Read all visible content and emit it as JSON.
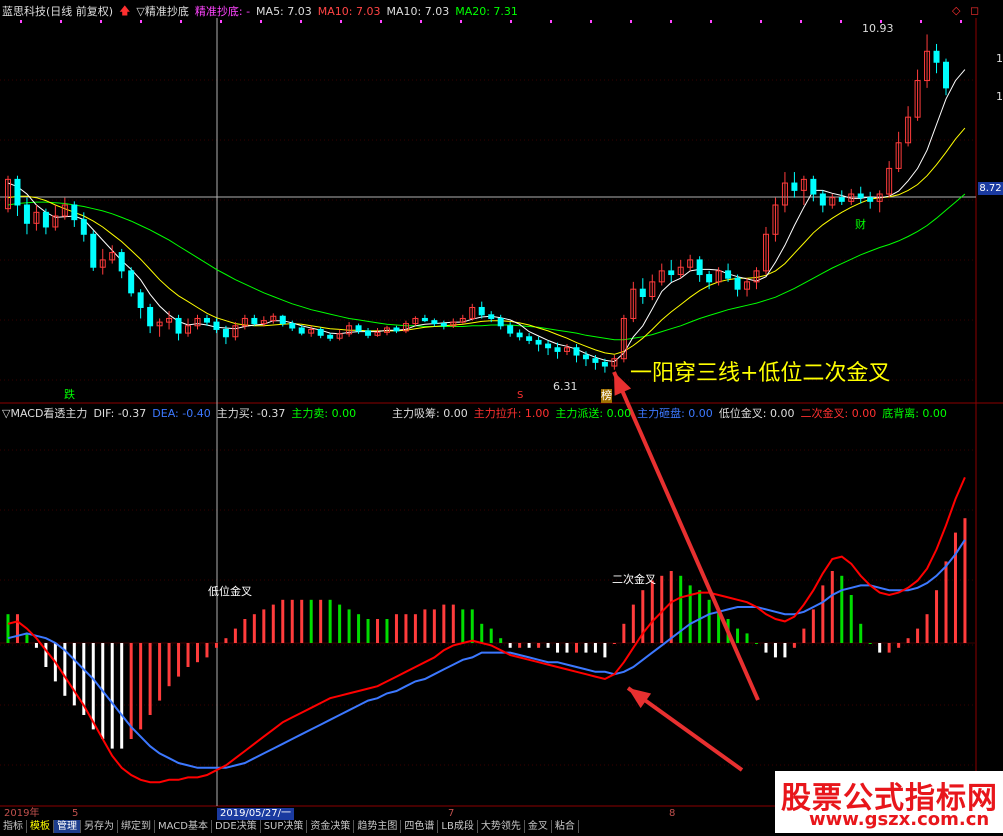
{
  "header": {
    "stock_title": "蓝思科技(日线 前复权)",
    "indicator_name": "▽精准抄底",
    "indicator_label": "精准抄底: -",
    "ma5": "MA5: 7.03",
    "ma10": "MA10: 7.03",
    "ma10b": "MA10: 7.03",
    "ma20": "MA20: 7.31"
  },
  "price_panel": {
    "high_label": "10.93",
    "low_label": "6.31",
    "current_price_tag": "8.72",
    "right_ticks": [
      "1",
      "1"
    ],
    "markers": {
      "die": "跌",
      "bang": "榜",
      "cai": "财",
      "s": "S"
    },
    "annotation": "一阳穿三线+低位二次金叉"
  },
  "macd_header": {
    "name": "▽MACD看透主力",
    "dif": "DIF: -0.37",
    "dea": "DEA: -0.40",
    "zlm": "主力买: -0.37",
    "zlmc": "主力卖: 0.00",
    "xichou": "主力吸筹: 0.00",
    "lasheng": "主力拉升: 1.00",
    "paisong": "主力派送: 0.00",
    "zapan": "主力砸盘: 0.00",
    "dwjc": "低位金叉: 0.00",
    "ecjc": "二次金叉: 0.00",
    "dbl": "底背离: 0.00"
  },
  "macd_panel": {
    "label_low_cross": "低位金叉",
    "label_second_cross": "二次金叉"
  },
  "x_axis": {
    "year": "2019年",
    "m5": "5",
    "date_cursor": "2019/05/27/一",
    "m7": "7",
    "m8": "8"
  },
  "tabs": [
    "指标",
    "模板",
    "管理",
    "另存为",
    "绑定到",
    "MACD基本",
    "DDE决策",
    "SUP决策",
    "资金决策",
    "趋势主图",
    "四色谱",
    "LB成段",
    "大势领先",
    "金叉",
    "粘合"
  ],
  "watermark": {
    "line1": "股票公式指标网",
    "line2": "www.gszx.com.cn"
  },
  "colors": {
    "up": "#ff3c3c",
    "down": "#00ffff",
    "ma5": "#ffffff",
    "ma10": "#ffff00",
    "ma20": "#00ff00",
    "dif": "#ff0000",
    "dea": "#3c78ff",
    "annot": "#ffff00"
  },
  "chart_data": {
    "type": "candlestick",
    "candles": [
      {
        "o": 8.55,
        "c": 8.95,
        "h": 9.0,
        "l": 8.5
      },
      {
        "o": 8.95,
        "c": 8.6,
        "h": 9.0,
        "l": 8.45
      },
      {
        "o": 8.6,
        "c": 8.35,
        "h": 8.7,
        "l": 8.2
      },
      {
        "o": 8.35,
        "c": 8.5,
        "h": 8.6,
        "l": 8.25
      },
      {
        "o": 8.5,
        "c": 8.3,
        "h": 8.55,
        "l": 8.2
      },
      {
        "o": 8.3,
        "c": 8.45,
        "h": 8.6,
        "l": 8.25
      },
      {
        "o": 8.45,
        "c": 8.6,
        "h": 8.7,
        "l": 8.4
      },
      {
        "o": 8.6,
        "c": 8.4,
        "h": 8.65,
        "l": 8.3
      },
      {
        "o": 8.4,
        "c": 8.2,
        "h": 8.5,
        "l": 8.1
      },
      {
        "o": 8.2,
        "c": 7.75,
        "h": 8.25,
        "l": 7.7
      },
      {
        "o": 7.75,
        "c": 7.85,
        "h": 8.0,
        "l": 7.65
      },
      {
        "o": 7.85,
        "c": 7.95,
        "h": 8.05,
        "l": 7.8
      },
      {
        "o": 7.95,
        "c": 7.7,
        "h": 8.0,
        "l": 7.6
      },
      {
        "o": 7.7,
        "c": 7.4,
        "h": 7.75,
        "l": 7.35
      },
      {
        "o": 7.4,
        "c": 7.2,
        "h": 7.45,
        "l": 7.05
      },
      {
        "o": 7.2,
        "c": 6.95,
        "h": 7.25,
        "l": 6.85
      },
      {
        "o": 6.95,
        "c": 7.0,
        "h": 7.05,
        "l": 6.8
      },
      {
        "o": 7.0,
        "c": 7.05,
        "h": 7.15,
        "l": 6.9
      },
      {
        "o": 7.05,
        "c": 6.85,
        "h": 7.1,
        "l": 6.75
      },
      {
        "o": 6.85,
        "c": 6.95,
        "h": 7.05,
        "l": 6.8
      },
      {
        "o": 6.95,
        "c": 7.05,
        "h": 7.1,
        "l": 6.9
      },
      {
        "o": 7.05,
        "c": 7.0,
        "h": 7.1,
        "l": 6.95
      },
      {
        "o": 7.0,
        "c": 6.9,
        "h": 7.05,
        "l": 6.85
      },
      {
        "o": 6.9,
        "c": 6.8,
        "h": 6.95,
        "l": 6.7
      },
      {
        "o": 6.8,
        "c": 6.95,
        "h": 7.0,
        "l": 6.75
      },
      {
        "o": 6.95,
        "c": 7.05,
        "h": 7.1,
        "l": 6.9
      },
      {
        "o": 7.05,
        "c": 6.98,
        "h": 7.1,
        "l": 6.95
      },
      {
        "o": 6.98,
        "c": 7.02,
        "h": 7.08,
        "l": 6.94
      },
      {
        "o": 7.02,
        "c": 7.08,
        "h": 7.12,
        "l": 6.98
      },
      {
        "o": 7.08,
        "c": 6.98,
        "h": 7.1,
        "l": 6.94
      },
      {
        "o": 6.98,
        "c": 6.92,
        "h": 7.02,
        "l": 6.88
      },
      {
        "o": 6.92,
        "c": 6.85,
        "h": 6.96,
        "l": 6.82
      },
      {
        "o": 6.85,
        "c": 6.9,
        "h": 6.95,
        "l": 6.8
      },
      {
        "o": 6.9,
        "c": 6.82,
        "h": 6.93,
        "l": 6.78
      },
      {
        "o": 6.82,
        "c": 6.78,
        "h": 6.85,
        "l": 6.74
      },
      {
        "o": 6.78,
        "c": 6.84,
        "h": 6.9,
        "l": 6.75
      },
      {
        "o": 6.84,
        "c": 6.95,
        "h": 7.0,
        "l": 6.8
      },
      {
        "o": 6.95,
        "c": 6.88,
        "h": 6.98,
        "l": 6.84
      },
      {
        "o": 6.88,
        "c": 6.82,
        "h": 6.92,
        "l": 6.78
      },
      {
        "o": 6.82,
        "c": 6.86,
        "h": 6.92,
        "l": 6.8
      },
      {
        "o": 6.86,
        "c": 6.92,
        "h": 6.95,
        "l": 6.82
      },
      {
        "o": 6.92,
        "c": 6.88,
        "h": 6.95,
        "l": 6.85
      },
      {
        "o": 6.88,
        "c": 6.98,
        "h": 7.02,
        "l": 6.85
      },
      {
        "o": 6.98,
        "c": 7.05,
        "h": 7.08,
        "l": 6.95
      },
      {
        "o": 7.05,
        "c": 7.02,
        "h": 7.1,
        "l": 7.0
      },
      {
        "o": 7.02,
        "c": 6.98,
        "h": 7.05,
        "l": 6.94
      },
      {
        "o": 6.98,
        "c": 6.95,
        "h": 7.02,
        "l": 6.9
      },
      {
        "o": 6.95,
        "c": 7.0,
        "h": 7.05,
        "l": 6.92
      },
      {
        "o": 7.0,
        "c": 7.05,
        "h": 7.1,
        "l": 6.98
      },
      {
        "o": 7.05,
        "c": 7.2,
        "h": 7.25,
        "l": 7.02
      },
      {
        "o": 7.2,
        "c": 7.1,
        "h": 7.28,
        "l": 7.05
      },
      {
        "o": 7.1,
        "c": 7.05,
        "h": 7.15,
        "l": 7.0
      },
      {
        "o": 7.05,
        "c": 6.95,
        "h": 7.1,
        "l": 6.9
      },
      {
        "o": 6.95,
        "c": 6.85,
        "h": 7.0,
        "l": 6.8
      },
      {
        "o": 6.85,
        "c": 6.8,
        "h": 6.9,
        "l": 6.75
      },
      {
        "o": 6.8,
        "c": 6.75,
        "h": 6.85,
        "l": 6.7
      },
      {
        "o": 6.75,
        "c": 6.7,
        "h": 6.8,
        "l": 6.6
      },
      {
        "o": 6.7,
        "c": 6.65,
        "h": 6.75,
        "l": 6.55
      },
      {
        "o": 6.65,
        "c": 6.6,
        "h": 6.72,
        "l": 6.5
      },
      {
        "o": 6.6,
        "c": 6.65,
        "h": 6.7,
        "l": 6.55
      },
      {
        "o": 6.65,
        "c": 6.55,
        "h": 6.7,
        "l": 6.45
      },
      {
        "o": 6.55,
        "c": 6.5,
        "h": 6.6,
        "l": 6.4
      },
      {
        "o": 6.5,
        "c": 6.45,
        "h": 6.55,
        "l": 6.35
      },
      {
        "o": 6.45,
        "c": 6.4,
        "h": 6.5,
        "l": 6.31
      },
      {
        "o": 6.4,
        "c": 6.5,
        "h": 6.55,
        "l": 6.35
      },
      {
        "o": 6.5,
        "c": 7.05,
        "h": 7.1,
        "l": 6.45
      },
      {
        "o": 7.05,
        "c": 7.45,
        "h": 7.55,
        "l": 7.0
      },
      {
        "o": 7.45,
        "c": 7.35,
        "h": 7.6,
        "l": 7.25
      },
      {
        "o": 7.35,
        "c": 7.55,
        "h": 7.65,
        "l": 7.3
      },
      {
        "o": 7.55,
        "c": 7.7,
        "h": 7.8,
        "l": 7.5
      },
      {
        "o": 7.7,
        "c": 7.65,
        "h": 7.85,
        "l": 7.55
      },
      {
        "o": 7.65,
        "c": 7.75,
        "h": 7.85,
        "l": 7.6
      },
      {
        "o": 7.75,
        "c": 7.85,
        "h": 7.92,
        "l": 7.7
      },
      {
        "o": 7.85,
        "c": 7.65,
        "h": 7.9,
        "l": 7.55
      },
      {
        "o": 7.65,
        "c": 7.55,
        "h": 7.7,
        "l": 7.45
      },
      {
        "o": 7.55,
        "c": 7.7,
        "h": 7.75,
        "l": 7.5
      },
      {
        "o": 7.7,
        "c": 7.6,
        "h": 7.8,
        "l": 7.55
      },
      {
        "o": 7.6,
        "c": 7.45,
        "h": 7.65,
        "l": 7.35
      },
      {
        "o": 7.45,
        "c": 7.55,
        "h": 7.6,
        "l": 7.35
      },
      {
        "o": 7.55,
        "c": 7.7,
        "h": 7.75,
        "l": 7.45
      },
      {
        "o": 7.7,
        "c": 8.2,
        "h": 8.3,
        "l": 7.65
      },
      {
        "o": 8.2,
        "c": 8.6,
        "h": 8.7,
        "l": 8.1
      },
      {
        "o": 8.6,
        "c": 8.9,
        "h": 9.05,
        "l": 8.5
      },
      {
        "o": 8.9,
        "c": 8.8,
        "h": 9.05,
        "l": 8.7
      },
      {
        "o": 8.8,
        "c": 8.95,
        "h": 9.0,
        "l": 8.6
      },
      {
        "o": 8.95,
        "c": 8.75,
        "h": 9.0,
        "l": 8.65
      },
      {
        "o": 8.75,
        "c": 8.6,
        "h": 8.8,
        "l": 8.5
      },
      {
        "o": 8.6,
        "c": 8.7,
        "h": 8.75,
        "l": 8.55
      },
      {
        "o": 8.7,
        "c": 8.65,
        "h": 8.8,
        "l": 8.6
      },
      {
        "o": 8.65,
        "c": 8.75,
        "h": 8.82,
        "l": 8.6
      },
      {
        "o": 8.75,
        "c": 8.7,
        "h": 8.85,
        "l": 8.62
      },
      {
        "o": 8.7,
        "c": 8.65,
        "h": 8.78,
        "l": 8.55
      },
      {
        "o": 8.65,
        "c": 8.75,
        "h": 8.8,
        "l": 8.5
      },
      {
        "o": 8.75,
        "c": 9.1,
        "h": 9.2,
        "l": 8.7
      },
      {
        "o": 9.1,
        "c": 9.45,
        "h": 9.6,
        "l": 9.05
      },
      {
        "o": 9.45,
        "c": 9.8,
        "h": 9.95,
        "l": 9.4
      },
      {
        "o": 9.8,
        "c": 10.3,
        "h": 10.45,
        "l": 9.75
      },
      {
        "o": 10.3,
        "c": 10.7,
        "h": 10.93,
        "l": 10.2
      },
      {
        "o": 10.7,
        "c": 10.55,
        "h": 10.8,
        "l": 10.4
      },
      {
        "o": 10.55,
        "c": 10.2,
        "h": 10.6,
        "l": 10.1
      }
    ],
    "ma5": [
      8.9,
      8.85,
      8.75,
      8.6,
      8.5,
      8.43,
      8.44,
      8.45,
      8.4,
      8.26,
      8.12,
      7.98,
      7.84,
      7.72,
      7.58,
      7.38,
      7.22,
      7.1,
      7.01,
      6.96,
      6.98,
      6.96,
      6.93,
      6.92,
      6.91,
      6.94,
      6.96,
      6.97,
      7.02,
      7.02,
      6.99,
      6.95,
      6.92,
      6.89,
      6.85,
      6.84,
      6.86,
      6.87,
      6.87,
      6.87,
      6.89,
      6.89,
      6.9,
      6.95,
      6.97,
      6.98,
      6.99,
      7.0,
      7.0,
      7.04,
      7.07,
      7.08,
      7.06,
      7.03,
      6.97,
      6.87,
      6.81,
      6.75,
      6.7,
      6.67,
      6.63,
      6.57,
      6.52,
      6.48,
      6.46,
      6.58,
      6.8,
      6.95,
      7.18,
      7.42,
      7.54,
      7.6,
      7.7,
      7.72,
      7.72,
      7.71,
      7.66,
      7.62,
      7.59,
      7.56,
      7.62,
      7.82,
      8.05,
      8.32,
      8.57,
      8.8,
      8.8,
      8.76,
      8.73,
      8.69,
      8.69,
      8.71,
      8.7,
      8.72,
      8.79,
      8.93,
      9.1,
      9.35,
      9.7,
      10.05,
      10.3,
      10.45
    ],
    "ma10": [
      8.7,
      8.72,
      8.72,
      8.7,
      8.66,
      8.6,
      8.55,
      8.5,
      8.45,
      8.38,
      8.3,
      8.2,
      8.1,
      7.98,
      7.86,
      7.72,
      7.58,
      7.46,
      7.36,
      7.28,
      7.2,
      7.12,
      7.06,
      7.02,
      6.98,
      6.96,
      6.95,
      6.95,
      6.96,
      6.97,
      6.98,
      6.97,
      6.95,
      6.93,
      6.91,
      6.9,
      6.89,
      6.89,
      6.88,
      6.88,
      6.88,
      6.88,
      6.89,
      6.91,
      6.93,
      6.94,
      6.95,
      6.96,
      6.97,
      6.99,
      7.01,
      7.02,
      7.02,
      7.01,
      6.99,
      6.96,
      6.92,
      6.88,
      6.83,
      6.78,
      6.72,
      6.67,
      6.62,
      6.58,
      6.56,
      6.6,
      6.68,
      6.78,
      6.9,
      7.03,
      7.14,
      7.24,
      7.34,
      7.43,
      7.5,
      7.55,
      7.58,
      7.6,
      7.6,
      7.61,
      7.64,
      7.7,
      7.8,
      7.94,
      8.08,
      8.22,
      8.33,
      8.42,
      8.5,
      8.57,
      8.63,
      8.68,
      8.7,
      8.71,
      8.74,
      8.8,
      8.88,
      9.0,
      9.15,
      9.32,
      9.5,
      9.65
    ],
    "ma20": [
      8.6,
      8.62,
      8.63,
      8.64,
      8.64,
      8.63,
      8.62,
      8.6,
      8.58,
      8.55,
      8.52,
      8.48,
      8.43,
      8.38,
      8.32,
      8.26,
      8.19,
      8.12,
      8.04,
      7.96,
      7.88,
      7.8,
      7.72,
      7.65,
      7.58,
      7.52,
      7.46,
      7.4,
      7.35,
      7.3,
      7.25,
      7.21,
      7.17,
      7.14,
      7.11,
      7.08,
      7.05,
      7.03,
      7.01,
      6.99,
      6.97,
      6.96,
      6.95,
      6.95,
      6.94,
      6.94,
      6.94,
      6.94,
      6.94,
      6.95,
      6.95,
      6.96,
      6.96,
      6.96,
      6.95,
      6.94,
      6.93,
      6.91,
      6.89,
      6.87,
      6.85,
      6.82,
      6.8,
      6.78,
      6.76,
      6.76,
      6.78,
      6.8,
      6.83,
      6.87,
      6.91,
      6.95,
      7.0,
      7.05,
      7.09,
      7.13,
      7.17,
      7.2,
      7.23,
      7.26,
      7.3,
      7.34,
      7.4,
      7.46,
      7.53,
      7.6,
      7.67,
      7.74,
      7.8,
      7.86,
      7.92,
      7.97,
      8.02,
      8.06,
      8.11,
      8.17,
      8.24,
      8.32,
      8.42,
      8.53,
      8.64,
      8.75
    ],
    "macd_dif": [
      0.08,
      0.09,
      0.06,
      0.02,
      -0.03,
      -0.08,
      -0.14,
      -0.2,
      -0.26,
      -0.33,
      -0.4,
      -0.47,
      -0.52,
      -0.55,
      -0.57,
      -0.58,
      -0.58,
      -0.57,
      -0.57,
      -0.56,
      -0.56,
      -0.55,
      -0.53,
      -0.51,
      -0.48,
      -0.45,
      -0.42,
      -0.39,
      -0.36,
      -0.33,
      -0.31,
      -0.29,
      -0.27,
      -0.25,
      -0.23,
      -0.22,
      -0.21,
      -0.2,
      -0.19,
      -0.18,
      -0.16,
      -0.14,
      -0.12,
      -0.1,
      -0.08,
      -0.06,
      -0.03,
      -0.01,
      0.0,
      0.01,
      0.0,
      -0.01,
      -0.03,
      -0.05,
      -0.06,
      -0.07,
      -0.08,
      -0.09,
      -0.1,
      -0.11,
      -0.12,
      -0.13,
      -0.14,
      -0.15,
      -0.13,
      -0.08,
      -0.02,
      0.04,
      0.09,
      0.13,
      0.17,
      0.19,
      0.2,
      0.21,
      0.21,
      0.2,
      0.19,
      0.18,
      0.17,
      0.15,
      0.12,
      0.1,
      0.09,
      0.11,
      0.16,
      0.22,
      0.29,
      0.35,
      0.36,
      0.33,
      0.28,
      0.24,
      0.21,
      0.2,
      0.21,
      0.23,
      0.26,
      0.31,
      0.39,
      0.49,
      0.6,
      0.69
    ],
    "macd_dea": [
      0.02,
      0.03,
      0.04,
      0.03,
      0.02,
      0.0,
      -0.03,
      -0.07,
      -0.11,
      -0.15,
      -0.2,
      -0.25,
      -0.3,
      -0.35,
      -0.39,
      -0.43,
      -0.46,
      -0.48,
      -0.5,
      -0.51,
      -0.52,
      -0.52,
      -0.52,
      -0.52,
      -0.51,
      -0.5,
      -0.48,
      -0.46,
      -0.44,
      -0.42,
      -0.4,
      -0.38,
      -0.36,
      -0.34,
      -0.32,
      -0.3,
      -0.28,
      -0.26,
      -0.24,
      -0.23,
      -0.21,
      -0.2,
      -0.18,
      -0.16,
      -0.15,
      -0.13,
      -0.11,
      -0.09,
      -0.07,
      -0.06,
      -0.04,
      -0.04,
      -0.04,
      -0.04,
      -0.05,
      -0.06,
      -0.07,
      -0.08,
      -0.08,
      -0.09,
      -0.1,
      -0.11,
      -0.12,
      -0.12,
      -0.13,
      -0.12,
      -0.1,
      -0.07,
      -0.04,
      -0.01,
      0.02,
      0.05,
      0.08,
      0.1,
      0.12,
      0.13,
      0.14,
      0.15,
      0.15,
      0.15,
      0.14,
      0.13,
      0.12,
      0.12,
      0.13,
      0.15,
      0.17,
      0.2,
      0.22,
      0.23,
      0.24,
      0.24,
      0.23,
      0.22,
      0.22,
      0.22,
      0.23,
      0.25,
      0.28,
      0.32,
      0.37,
      0.43
    ]
  }
}
